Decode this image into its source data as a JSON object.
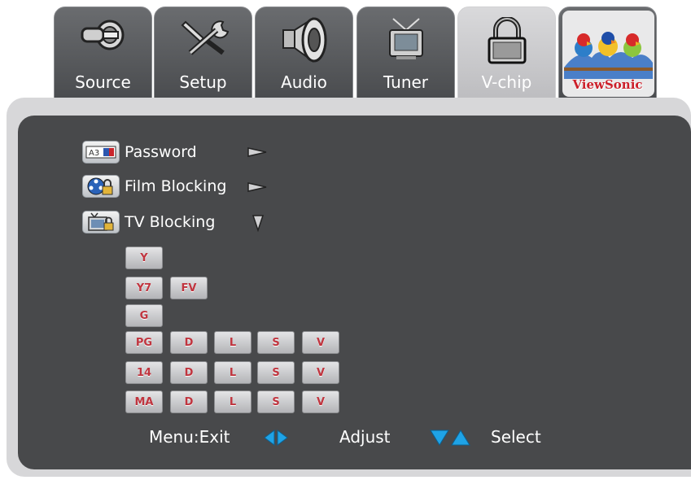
{
  "tabs": [
    {
      "label": "Source",
      "icon": "source-cable-icon",
      "active": false
    },
    {
      "label": "Setup",
      "icon": "tools-icon",
      "active": false
    },
    {
      "label": "Audio",
      "icon": "speaker-icon",
      "active": false
    },
    {
      "label": "Tuner",
      "icon": "tv-antenna-icon",
      "active": false
    },
    {
      "label": "V-chip",
      "icon": "padlock-icon",
      "active": true
    }
  ],
  "brand": {
    "name": "ViewSonic",
    "icon": "viewsonic-birds-logo"
  },
  "menu": [
    {
      "label": "Password",
      "icon": "password-keypad-icon",
      "arrow": "right"
    },
    {
      "label": "Film Blocking",
      "icon": "film-lock-icon",
      "arrow": "right"
    },
    {
      "label": "TV Blocking",
      "icon": "tv-lock-icon",
      "arrow": "down"
    }
  ],
  "tv_ratings": [
    {
      "rating": "Y",
      "content": []
    },
    {
      "rating": "Y7",
      "content": [
        "FV"
      ]
    },
    {
      "rating": "G",
      "content": []
    },
    {
      "rating": "PG",
      "content": [
        "D",
        "L",
        "S",
        "V"
      ]
    },
    {
      "rating": "14",
      "content": [
        "D",
        "L",
        "S",
        "V"
      ]
    },
    {
      "rating": "MA",
      "content": [
        "D",
        "L",
        "S",
        "V"
      ]
    }
  ],
  "footer": {
    "exit": "Menu:Exit",
    "adjust": "Adjust",
    "select": "Select"
  },
  "colors": {
    "panel": "#48494b",
    "frame": "#d7d7d9",
    "accent_blue": "#1fa3e6",
    "rating_text": "#c0343e"
  }
}
